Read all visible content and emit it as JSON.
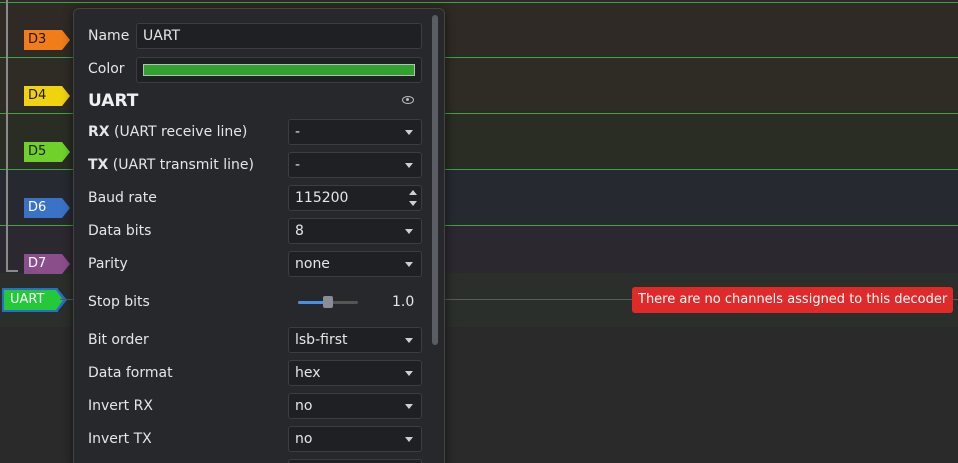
{
  "channels": [
    {
      "label": "D3",
      "color": "#f07c1a"
    },
    {
      "label": "D4",
      "color": "#f0d20e"
    },
    {
      "label": "D5",
      "color": "#6fd12a"
    },
    {
      "label": "D6",
      "color": "#3a72c8"
    },
    {
      "label": "D7",
      "color": "#8a4f8a"
    }
  ],
  "decoder": {
    "tag_label": "UART",
    "error": "There are no channels assigned to this decoder"
  },
  "panel": {
    "name_label": "Name",
    "name_value": "UART",
    "color_label": "Color",
    "color_value": "#2ea42e",
    "section_title": "UART",
    "rx": {
      "label_bold": "RX",
      "label_rest": " (UART receive line)",
      "value": "-"
    },
    "tx": {
      "label_bold": "TX",
      "label_rest": " (UART transmit line)",
      "value": "-"
    },
    "baud": {
      "label": "Baud rate",
      "value": "115200"
    },
    "data_bits": {
      "label": "Data bits",
      "value": "8"
    },
    "parity": {
      "label": "Parity",
      "value": "none"
    },
    "stop_bits": {
      "label": "Stop bits",
      "value": "1.0",
      "fraction": 0.5
    },
    "bit_order": {
      "label": "Bit order",
      "value": "lsb-first"
    },
    "data_format": {
      "label": "Data format",
      "value": "hex"
    },
    "invert_rx": {
      "label": "Invert RX",
      "value": "no"
    },
    "invert_tx": {
      "label": "Invert TX",
      "value": "no"
    }
  }
}
